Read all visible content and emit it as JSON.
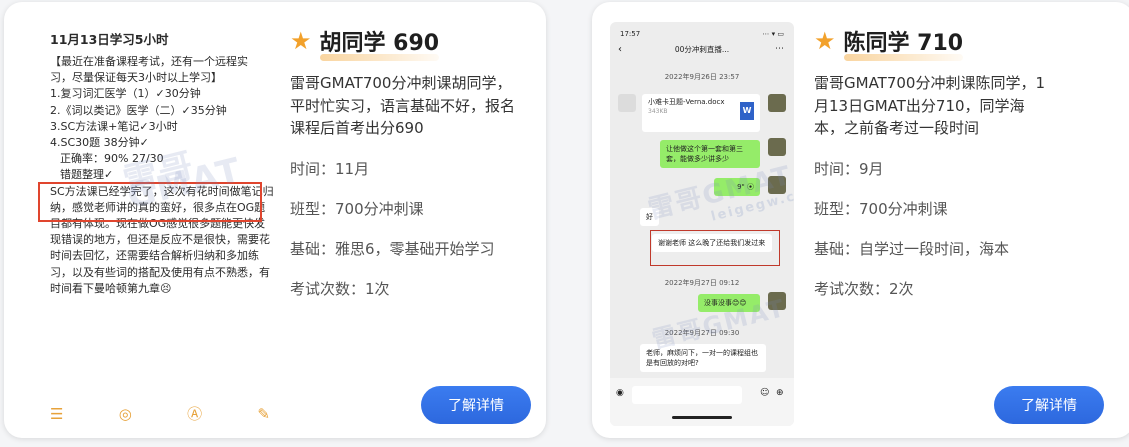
{
  "cards": [
    {
      "student_name": "胡同学 690",
      "description": "雷哥GMAT700分冲刺课胡同学，平时忙实习，语言基础不好，报名课程后首考出分690",
      "time": "时间：11月",
      "class_type": "班型：700分冲刺课",
      "foundation": "基础：雅思6，零基础开始学习",
      "attempts": "考试次数：1次",
      "button_label": "了解详情",
      "note": {
        "title": "11月13日学习5小时",
        "lines": [
          "【最近在准备课程考试，还有一个远程实",
          "习，尽量保证每天3小时以上学习】",
          "1.复习词汇医学（1）✓30分钟",
          "2.《词以类记》医学（二）✓35分钟",
          "3.SC方法课+笔记✓3小时",
          "4.SC30题 38分钟✓",
          "正确率：90% 27/30",
          "错题整理✓"
        ],
        "paragraph": "SC方法课已经学完了，这次有花时间做笔记归纳，感觉老师讲的真的蛮好，很多点在OG题目都有体现。现在做OG感觉很多题能更快发现错误的地方，但还是反应不是很快，需要花时间去回忆，还需要结合解析归纳和多加练习，以及有些词的搭配及使用有点不熟悉，有时间看下曼哈顿第九章😣",
        "watermark": "雷哥GMAT"
      }
    },
    {
      "student_name": "陈同学 710",
      "description": "雷哥GMAT700分冲刺课陈同学，1月13日GMAT出分710，同学海本，之前备考过一段时间",
      "time": "时间：9月",
      "class_type": "班型：700分冲刺课",
      "foundation": "基础：自学过一段时间，海本",
      "attempts": "考试次数：2次",
      "button_label": "了解详情",
      "chat": {
        "status_time": "17:57",
        "status_icons": "⋯ ▾ ▭",
        "title": "00分冲刺直播...",
        "timestamp1": "2022年9月26日 23:57",
        "file_name": "小难卡丑题-Verna.docx",
        "file_size": "343KB",
        "msg1": "让他做这个第一套和第三套，能做多少讲多少",
        "voice": "9\" ⦿",
        "msg_good": "好",
        "msg2": "谢谢老师 这么晚了还给我们发过来",
        "timestamp2": "2022年9月27日 09:12",
        "msg3": "没事没事😊😊",
        "timestamp3": "2022年9月27日 09:30",
        "msg4": "老师，麻烦问下，一对一的课程组也是有回放的对吧?",
        "watermark": "雷哥GMAT",
        "watermark_url": "leigegw.cn"
      }
    }
  ]
}
